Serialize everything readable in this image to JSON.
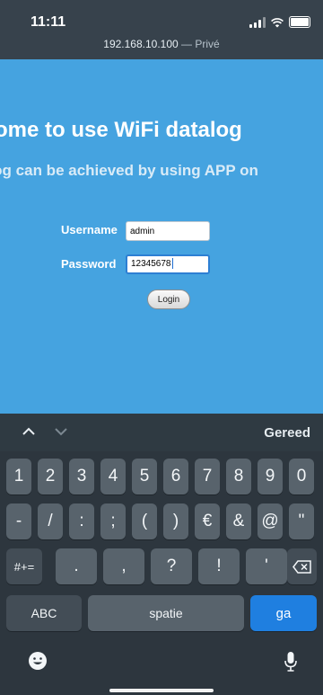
{
  "status": {
    "time": "11:11"
  },
  "browser": {
    "host": "192.168.10.100",
    "separator": " — ",
    "mode": "Privé"
  },
  "page": {
    "title": "lcome to use WiFi datalog",
    "subtitle": "alog can be achieved by using APP on",
    "username_label": "Username",
    "username_value": "admin",
    "password_label": "Password",
    "password_value": "12345678",
    "login_label": "Login"
  },
  "keyboard": {
    "done_label": "Gereed",
    "row1": [
      "1",
      "2",
      "3",
      "4",
      "5",
      "6",
      "7",
      "8",
      "9",
      "0"
    ],
    "row2": [
      "-",
      "/",
      ":",
      ";",
      "(",
      ")",
      "€",
      "&",
      "@",
      "\""
    ],
    "row3": [
      "#+=",
      ".",
      ",",
      "?",
      "!",
      "'"
    ],
    "abc_label": "ABC",
    "space_label": "spatie",
    "go_label": "ga"
  },
  "colors": {
    "page_bg": "#45a3e0",
    "go_key": "#1f7fe0",
    "keyboard_bg": "#2d363e"
  }
}
